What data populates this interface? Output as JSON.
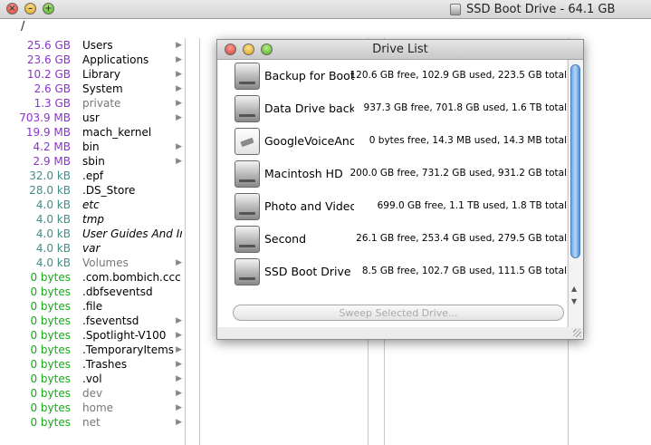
{
  "window": {
    "title": "SSD Boot Drive - 64.1 GB"
  },
  "path": "/",
  "files": [
    {
      "size": "25.6 GB",
      "name": "Users",
      "size_color": "purple",
      "arrow": true
    },
    {
      "size": "23.6 GB",
      "name": "Applications",
      "size_color": "purple",
      "arrow": true
    },
    {
      "size": "10.2 GB",
      "name": "Library",
      "size_color": "purple",
      "arrow": true
    },
    {
      "size": "2.6 GB",
      "name": "System",
      "size_color": "purple",
      "arrow": true
    },
    {
      "size": "1.3 GB",
      "name": "private",
      "size_color": "purple",
      "arrow": true,
      "name_style": "grey"
    },
    {
      "size": "703.9 MB",
      "name": "usr",
      "size_color": "purple",
      "arrow": true
    },
    {
      "size": "19.9 MB",
      "name": "mach_kernel",
      "size_color": "purple",
      "arrow": false
    },
    {
      "size": "4.2 MB",
      "name": "bin",
      "size_color": "purple",
      "arrow": true
    },
    {
      "size": "2.9 MB",
      "name": "sbin",
      "size_color": "purple",
      "arrow": true
    },
    {
      "size": "32.0 kB",
      "name": ".epf",
      "size_color": "teal",
      "arrow": false
    },
    {
      "size": "28.0 kB",
      "name": ".DS_Store",
      "size_color": "teal",
      "arrow": false
    },
    {
      "size": "4.0 kB",
      "name": "etc",
      "size_color": "teal",
      "arrow": false,
      "name_style": "italic"
    },
    {
      "size": "4.0 kB",
      "name": "tmp",
      "size_color": "teal",
      "arrow": false,
      "name_style": "italic"
    },
    {
      "size": "4.0 kB",
      "name": "User Guides And Inf",
      "size_color": "teal",
      "arrow": false,
      "name_style": "italic"
    },
    {
      "size": "4.0 kB",
      "name": "var",
      "size_color": "teal",
      "arrow": false,
      "name_style": "italic"
    },
    {
      "size": "4.0 kB",
      "name": "Volumes",
      "size_color": "teal",
      "arrow": true,
      "name_style": "grey"
    },
    {
      "size": "0 bytes",
      "name": ".com.bombich.ccc.",
      "size_color": "green",
      "arrow": false
    },
    {
      "size": "0 bytes",
      "name": ".dbfseventsd",
      "size_color": "green",
      "arrow": false
    },
    {
      "size": "0 bytes",
      "name": ".file",
      "size_color": "green",
      "arrow": false
    },
    {
      "size": "0 bytes",
      "name": ".fseventsd",
      "size_color": "green",
      "arrow": true
    },
    {
      "size": "0 bytes",
      "name": ".Spotlight-V100",
      "size_color": "green",
      "arrow": true
    },
    {
      "size": "0 bytes",
      "name": ".TemporaryItems",
      "size_color": "green",
      "arrow": true
    },
    {
      "size": "0 bytes",
      "name": ".Trashes",
      "size_color": "green",
      "arrow": true
    },
    {
      "size": "0 bytes",
      "name": ".vol",
      "size_color": "green",
      "arrow": true
    },
    {
      "size": "0 bytes",
      "name": "dev",
      "size_color": "green",
      "arrow": true,
      "name_style": "grey"
    },
    {
      "size": "0 bytes",
      "name": "home",
      "size_color": "green",
      "arrow": true,
      "name_style": "grey"
    },
    {
      "size": "0 bytes",
      "name": "net",
      "size_color": "green",
      "arrow": true,
      "name_style": "grey"
    }
  ],
  "dialog": {
    "title": "Drive List",
    "drives": [
      {
        "name": "Backup for Boot Drive",
        "info": "120.6 GB free, 102.9 GB used, 223.5 GB total",
        "icon": "hard-drive-icon"
      },
      {
        "name": "Data Drive backup",
        "info": "937.3 GB free, 701.8 GB used, 1.6 TB total",
        "icon": "hard-drive-icon"
      },
      {
        "name": "GoogleVoiceAndVideo",
        "info": "0 bytes free, 14.3 MB used, 14.3 MB total",
        "icon": "disk-image-icon"
      },
      {
        "name": "Macintosh HD",
        "info": "200.0 GB free, 731.2 GB used, 931.2 GB total",
        "icon": "hard-drive-icon"
      },
      {
        "name": "Photo and Video",
        "info": "699.0 GB free, 1.1 TB used, 1.8 TB total",
        "icon": "hard-drive-icon"
      },
      {
        "name": "Second",
        "info": "26.1 GB free, 253.4 GB used, 279.5 GB total",
        "icon": "hard-drive-icon"
      },
      {
        "name": "SSD Boot Drive",
        "info": "8.5 GB free, 102.7 GB used, 111.5 GB total",
        "icon": "hard-drive-icon"
      }
    ],
    "sweep_label": "Sweep Selected Drive..."
  },
  "colors": {
    "purple": "#8b33cc",
    "teal": "#3f8f86",
    "green": "#19a817"
  }
}
